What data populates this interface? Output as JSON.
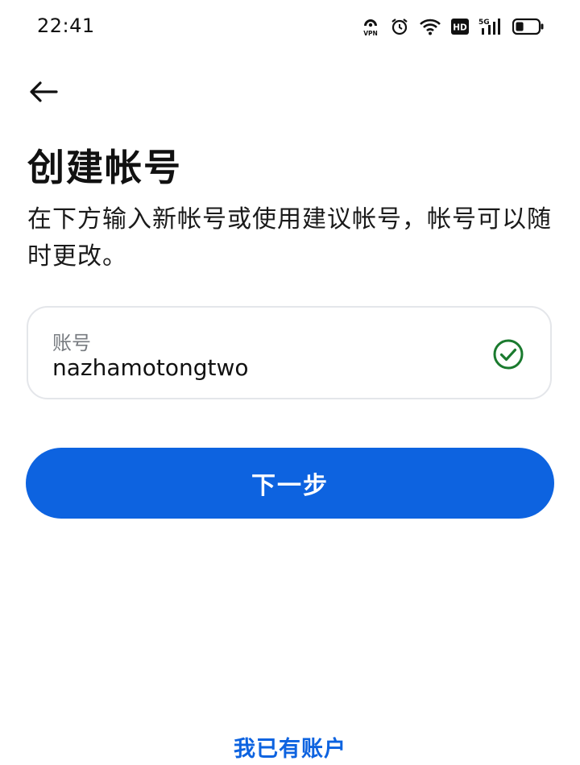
{
  "status_bar": {
    "time": "22:41",
    "vpn_label": "VPN",
    "hd_label": "HD",
    "network_label": "5G",
    "icons": [
      "vpn-icon",
      "alarm-icon",
      "wifi-icon",
      "hd-icon",
      "signal-icon",
      "battery-icon"
    ],
    "battery_level": 0.35
  },
  "header": {
    "back_icon": "back-arrow-icon"
  },
  "main": {
    "title": "创建帐号",
    "description": "在下方输入新帐号或使用建议帐号，帐号可以随时更改。",
    "account_field": {
      "label": "账号",
      "value": "nazhamotongtwo",
      "status_icon": "check-circle-icon",
      "status_color": "#1a7a2e"
    },
    "next_button": "下一步"
  },
  "footer": {
    "have_account_link": "我已有账户"
  },
  "colors": {
    "accent": "#0d63e0",
    "background": "#ffffff"
  }
}
